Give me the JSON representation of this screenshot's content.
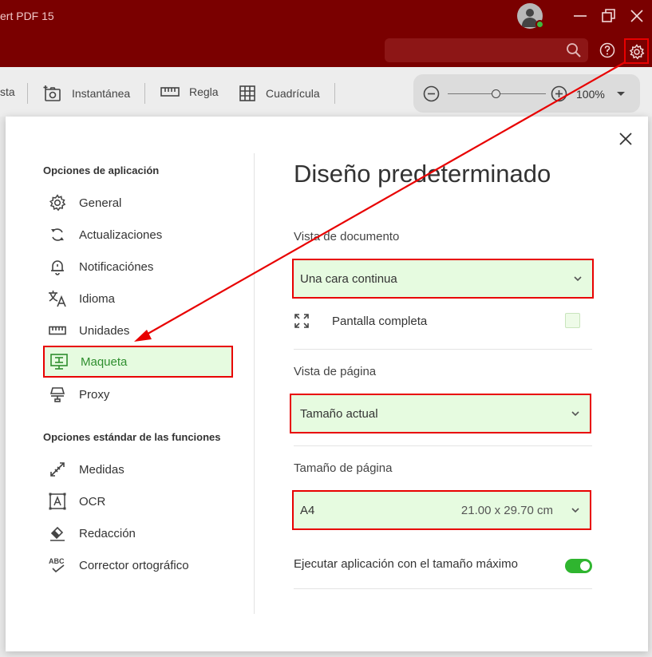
{
  "window": {
    "title": "ert PDF 15"
  },
  "search": {
    "placeholder": ""
  },
  "toolbar": {
    "items": [
      {
        "label": "sta"
      },
      {
        "label": "Instantánea",
        "icon": "snapshot-icon"
      },
      {
        "label": "Regla",
        "icon": "ruler-icon"
      },
      {
        "label": "Cuadrícula",
        "icon": "grid-icon"
      }
    ],
    "zoom": {
      "value": "100%"
    }
  },
  "dialog": {
    "sections": [
      {
        "title": "Opciones de aplicación",
        "items": [
          {
            "label": "General",
            "icon": "gear-icon"
          },
          {
            "label": "Actualizaciones",
            "icon": "refresh-icon"
          },
          {
            "label": "Notificaciónes",
            "icon": "bell-icon"
          },
          {
            "label": "Idioma",
            "icon": "translate-icon"
          },
          {
            "label": "Unidades",
            "icon": "ruler-icon"
          },
          {
            "label": "Maqueta",
            "icon": "layout-icon",
            "active": true
          },
          {
            "label": "Proxy",
            "icon": "network-icon"
          }
        ]
      },
      {
        "title": "Opciones estándar de las funciones",
        "items": [
          {
            "label": "Medidas",
            "icon": "measure-icon"
          },
          {
            "label": "OCR",
            "icon": "ocr-icon"
          },
          {
            "label": "Redacción",
            "icon": "eraser-icon"
          },
          {
            "label": "Corrector ortográfico",
            "icon": "spellcheck-icon"
          }
        ]
      }
    ],
    "main": {
      "title": "Diseño predeterminado",
      "document_view": {
        "label": "Vista de documento",
        "value": "Una cara continua"
      },
      "fullscreen": {
        "label": "Pantalla completa",
        "checked": false
      },
      "page_view": {
        "label": "Vista de página",
        "value": "Tamaño actual"
      },
      "page_size": {
        "label": "Tamaño de página",
        "value": "A4",
        "dimensions": "21.00 x 29.70 cm"
      },
      "maximize": {
        "label": "Ejecutar aplicación con el tamaño máximo",
        "enabled": true
      }
    }
  },
  "colors": {
    "titlebar": "#7a0000",
    "highlight_border": "#e80000",
    "highlight_fill": "#e6fbe0",
    "active_text": "#2f8f2f",
    "toggle_on": "#2fb52f"
  }
}
